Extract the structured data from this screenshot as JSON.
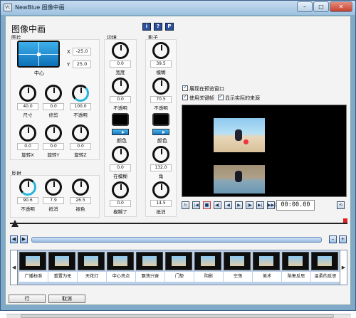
{
  "window": {
    "title": "NewBlue 图像中画",
    "app_icon": "Vc",
    "controls": {
      "minimize": "–",
      "maximize": "□",
      "close": "✕"
    }
  },
  "heading": "图像中画",
  "help_buttons": [
    "i",
    "?",
    "P"
  ],
  "sections": {
    "image": "图片",
    "border": "边境",
    "shadow": "影子",
    "reflection": "反射"
  },
  "position": {
    "caption": "中心",
    "x_label": "X",
    "x_value": "-25.0",
    "y_label": "Y",
    "y_value": "25.0"
  },
  "image_knobs": [
    {
      "value": "40.0",
      "label": "尺寸"
    },
    {
      "value": "0.0",
      "label": "修剪"
    },
    {
      "value": "100.0",
      "label": "不透明"
    },
    {
      "value": "0.0",
      "label": "旋转X"
    },
    {
      "value": "0.0",
      "label": "旋转Y"
    },
    {
      "value": "0.0",
      "label": "旋转Z"
    }
  ],
  "border_knobs": [
    {
      "value": "0.0",
      "label": "宽度"
    },
    {
      "value": "0.0",
      "label": "不透明"
    },
    {
      "value": "0.0",
      "label": "在模糊"
    },
    {
      "value": "0.0",
      "label": "模糊了"
    }
  ],
  "border_color_label": "颜色",
  "shadow_knobs": [
    {
      "value": "39.5",
      "label": "模糊"
    },
    {
      "value": "70.5",
      "label": "不透明"
    },
    {
      "value": "132.0",
      "label": "角"
    },
    {
      "value": "14.5",
      "label": "抵消"
    }
  ],
  "shadow_color_label": "颜色",
  "reflection_knobs": [
    {
      "value": "90.6",
      "label": "不透明"
    },
    {
      "value": "7.9",
      "label": "抵消"
    },
    {
      "value": "26.5",
      "label": "褪色"
    }
  ],
  "checkboxes": [
    {
      "label": "展现在预览窗口",
      "checked": true
    },
    {
      "label": "使用关键帧",
      "checked": true
    },
    {
      "label": "显示实际的来源",
      "checked": true
    }
  ],
  "transport": {
    "buttons": [
      "↻",
      "|◀",
      "■",
      "◀|",
      "◀",
      "▶",
      "|▶",
      "▶|",
      "▶▶|"
    ],
    "timecode": "00:00.00",
    "link_icon": "⟲"
  },
  "zoom": {
    "minus": "–",
    "plus": "+"
  },
  "presets": [
    "广播标准",
    "重置为无",
    "天花灯",
    "中心亮点",
    "飘荡兴奋",
    "门垫",
    "阴影",
    "空荡",
    "美术",
    "陷害反思",
    "温柔的反思"
  ],
  "strip_arrows": {
    "left": "◀",
    "right": "▶"
  },
  "footer": {
    "ok": "行",
    "cancel": "取消"
  },
  "colors": {
    "accent": "#1b76c0",
    "knob_accent": "#2ab4d9",
    "title_bar": "#9cc1e0"
  },
  "icons": {
    "knob": "rotary-knob-icon",
    "color_swatch": "color-swatch-icon",
    "checkbox": "checkbox-icon",
    "thumbnail": "beach-photo-icon"
  }
}
